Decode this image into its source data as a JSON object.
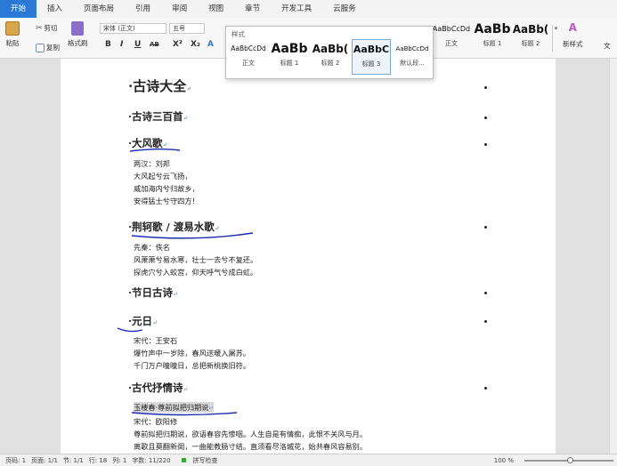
{
  "menu": {
    "tabs": [
      "开始",
      "插入",
      "页面布局",
      "引用",
      "审阅",
      "视图",
      "章节",
      "开发工具",
      "云服务"
    ]
  },
  "ribbon": {
    "paste": "粘贴",
    "cut": "剪切",
    "copy": "复制",
    "format_painter": "格式刷",
    "font_name": "宋体 (正文)",
    "font_size": "五号",
    "format_buttons": [
      "B",
      "I",
      "U",
      "AB",
      "X²",
      "X₂",
      "A"
    ],
    "styles_right": [
      {
        "preview": "AaBbCcDd",
        "name": "正文"
      },
      {
        "preview": "AaBb",
        "name": "标题 1"
      },
      {
        "preview": "AaBb(",
        "name": "标题 2"
      }
    ],
    "new_style": "新样式",
    "text_tools": "文"
  },
  "style_panel": {
    "title": "样式",
    "items": [
      {
        "preview": "AaBbCcDd",
        "name": "正文"
      },
      {
        "preview": "AaBb",
        "name": "标题 1"
      },
      {
        "preview": "AaBb(",
        "name": "标题 2"
      },
      {
        "preview": "AaBbC",
        "name": "标题 3"
      },
      {
        "preview": "AaBbCcDd",
        "name": "默认段..."
      }
    ]
  },
  "document": {
    "title": "古诗大全",
    "sec1": "古诗三百首",
    "poem1_title": "大风歌",
    "poem1_lines": [
      "两汉：刘邦",
      "大风起兮云飞扬，",
      "威加海内兮归故乡，",
      "安得猛士兮守四方！"
    ],
    "poem2_title": "荆轲歌 / 渡易水歌",
    "poem2_lines": [
      "先秦：佚名",
      "风萧萧兮易水寒，壮士一去兮不复还。",
      "探虎穴兮入蛟宫，仰天呼气兮成白虹。"
    ],
    "sec2": "节日古诗",
    "poem3_title": "元日",
    "poem3_lines": [
      "宋代：王安石",
      "爆竹声中一岁除，春风送暖入屠苏。",
      "千门万户曈曈日，总把新桃换旧符。"
    ],
    "sec3": "古代抒情诗",
    "poem4_title": "玉楼春·尊前拟把归期说",
    "poem4_lines": [
      "宋代：欧阳修",
      "尊前拟把归期说，欲语春容先惨咽。人生自是有情痴，此恨不关风与月。",
      "离歌且莫翻新阕，一曲能教肠寸结。直须看尽洛城花，始共春风容易别。"
    ],
    "para_mark": "↵"
  },
  "status": {
    "page_num": "页码: 1",
    "pages": "页面: 1/1",
    "section": "节: 1/1",
    "row": "行: 18",
    "col": "列: 1",
    "words": "字数: 11/220",
    "spell": "拼写检查",
    "zoom": "100 %"
  },
  "colors": {
    "accent": "#2b79d6",
    "ink": "#1a2bb0"
  }
}
